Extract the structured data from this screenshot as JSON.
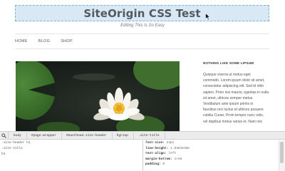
{
  "site": {
    "title": "SiteOrigin CSS Test",
    "tagline": "Editing This Is So Easy",
    "nav": [
      "HOME",
      "BLOG",
      "SHOP"
    ],
    "sidebar": {
      "widget_title": "NOTHING LIKE SOME LIPSUM",
      "lines": [
        "Quisque viverra ut metus eget",
        "commodo. Lorem ipsum dolor sit amet,",
        "consectetur adipiscing elit. Sed id nibh",
        "sapien. Proin nisi mauris, egestas in nulla",
        "sit amet, ultrices semper metus.",
        "Vestibulum ante ipsum primis in",
        "faucibus orci luctus et ultrices posuere",
        "cubilia Curae; Proin tempor nunc odio,",
        "vel dapibus metus varius et. Nam nec"
      ]
    }
  },
  "devtools": {
    "breadcrumbs": [
      "body",
      "#page-wrapper",
      "#masthead.site-header",
      "hgroup",
      ".site-title"
    ],
    "tree": [
      ".site-header h1",
      ".site-title",
      "h1"
    ],
    "styles": [
      {
        "prop": "font-size:",
        "val": "24px"
      },
      {
        "prop": "line-height:",
        "val": "1.8461538e"
      },
      {
        "prop": "text-align:",
        "val": "left"
      },
      {
        "prop": "margin-bottom:",
        "val": "1rem"
      },
      {
        "prop": "padding:",
        "val": "0"
      }
    ]
  },
  "colors": {
    "title_highlight": "#d9e8f5",
    "title_text": "#54595e",
    "devtools_bar": "#ececec"
  }
}
